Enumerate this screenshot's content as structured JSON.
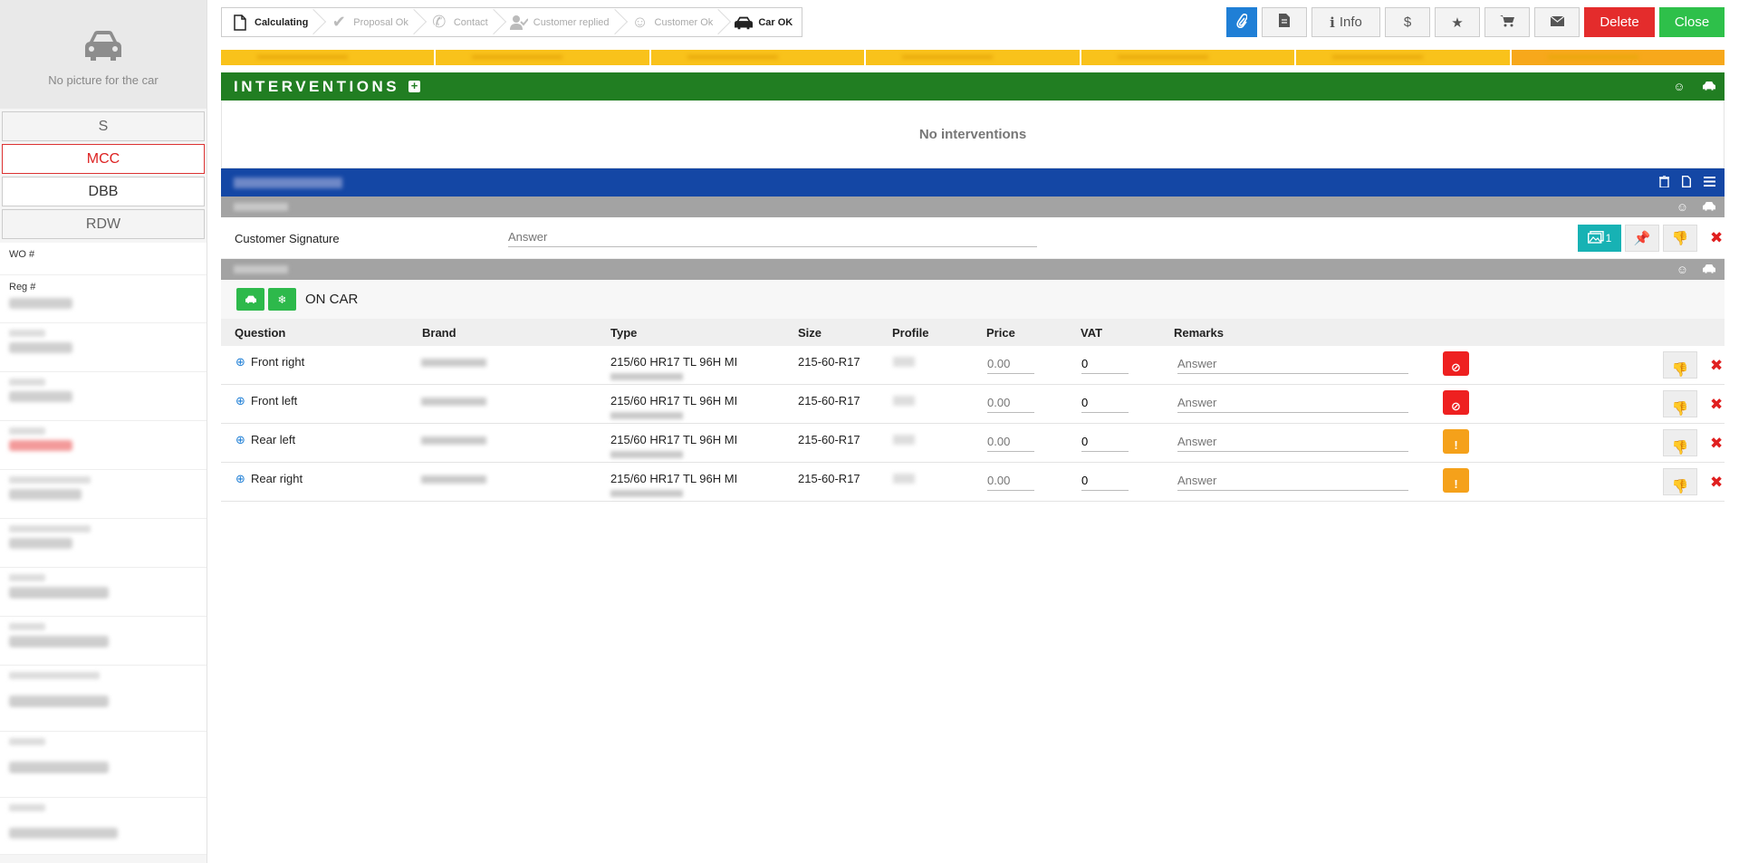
{
  "sidebar": {
    "no_picture": "No picture for the car",
    "codes": [
      "S",
      "MCC",
      "DBB",
      "RDW"
    ],
    "wo_label": "WO #",
    "reg_label": "Reg #"
  },
  "workflow": {
    "steps": [
      {
        "label": "Calculating",
        "icon": "file-icon",
        "done": true
      },
      {
        "label": "Proposal Ok",
        "icon": "check-icon",
        "done": false
      },
      {
        "label": "Contact",
        "icon": "phone-icon",
        "done": false
      },
      {
        "label": "Customer replied",
        "icon": "user-check-icon",
        "done": false
      },
      {
        "label": "Customer Ok",
        "icon": "smile-icon",
        "done": false
      },
      {
        "label": "Car OK",
        "icon": "car-icon",
        "done": true
      }
    ]
  },
  "actions": {
    "info_label": "Info",
    "delete_label": "Delete",
    "close_label": "Close",
    "dollar": "$"
  },
  "interventions": {
    "title": "INTERVENTIONS",
    "empty": "No interventions"
  },
  "signature": {
    "question": "Customer Signature",
    "placeholder": "Answer",
    "photo_count": "1"
  },
  "oncar": {
    "title": "ON CAR"
  },
  "table": {
    "headers": [
      "Question",
      "Brand",
      "Type",
      "Size",
      "Profile",
      "Price",
      "VAT",
      "Remarks"
    ],
    "rows": [
      {
        "question": "Front right",
        "type": "215/60 HR17 TL 96H MI",
        "size": "215-60-R17",
        "price_placeholder": "0.00",
        "vat": "0",
        "remarks_placeholder": "Answer",
        "status": "red"
      },
      {
        "question": "Front left",
        "type": "215/60 HR17 TL 96H MI",
        "size": "215-60-R17",
        "price_placeholder": "0.00",
        "vat": "0",
        "remarks_placeholder": "Answer",
        "status": "red"
      },
      {
        "question": "Rear left",
        "type": "215/60 HR17 TL 96H MI",
        "size": "215-60-R17",
        "price_placeholder": "0.00",
        "vat": "0",
        "remarks_placeholder": "Answer",
        "status": "orange"
      },
      {
        "question": "Rear right",
        "type": "215/60 HR17 TL 96H MI",
        "size": "215-60-R17",
        "price_placeholder": "0.00",
        "vat": "0",
        "remarks_placeholder": "Answer",
        "status": "orange"
      }
    ]
  },
  "colors": {
    "green": "#217e22",
    "blue": "#1447a5",
    "red": "#e42c2c",
    "orange": "#f5a11a",
    "teal": "#17b2b4"
  }
}
